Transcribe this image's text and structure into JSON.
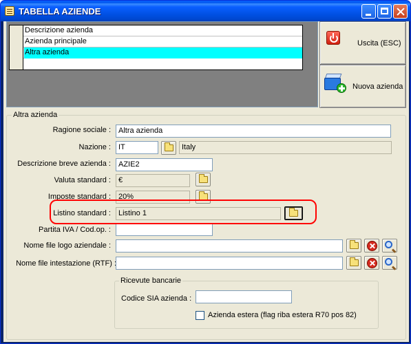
{
  "window": {
    "title": "TABELLA AZIENDE"
  },
  "grid": {
    "header": "Descrizione azienda",
    "rows": [
      "Azienda principale",
      "Altra azienda"
    ]
  },
  "buttons": {
    "exit": "Uscita (ESC)",
    "new": "Nuova azienda"
  },
  "form": {
    "group_title": "Altra azienda",
    "ragione_sociale": {
      "label": "Ragione sociale :",
      "value": "Altra azienda"
    },
    "nazione": {
      "label": "Nazione :",
      "code": "IT",
      "name": "Italy"
    },
    "descrizione_breve": {
      "label": "Descrizione breve azienda :",
      "value": "AZIE2"
    },
    "valuta": {
      "label": "Valuta standard :",
      "value": "€"
    },
    "imposte": {
      "label": "Imposte standard :",
      "value": "20%"
    },
    "listino": {
      "label": "Listino standard :",
      "value": "Listino 1"
    },
    "partita_iva": {
      "label": "Partita IVA / Cod.op. :",
      "value": ""
    },
    "logo": {
      "label": "Nome file logo aziendale :",
      "value": ""
    },
    "intestazione": {
      "label": "Nome file intestazione (RTF) :",
      "value": ""
    },
    "ricevute": {
      "title": "Ricevute bancarie",
      "sia_label": "Codice SIA azienda :",
      "sia_value": "",
      "estera_label": "Azienda estera (flag riba estera R70 pos 82)"
    }
  }
}
